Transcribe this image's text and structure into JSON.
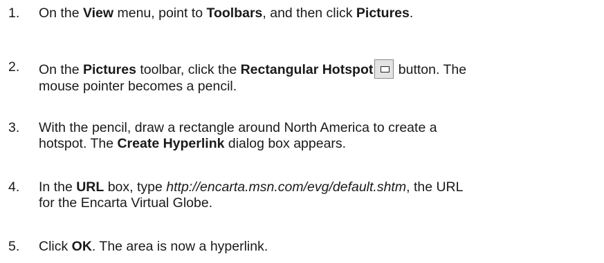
{
  "steps": [
    {
      "number": "1.",
      "parts": [
        "On the ",
        "View",
        " menu, point to ",
        "Toolbars",
        ", and then click ",
        "Pictures",
        "."
      ]
    },
    {
      "number": "2.",
      "line1_parts": [
        "On the ",
        "Pictures",
        " toolbar, click the ",
        "Rectangular Hotspot",
        " button. The"
      ],
      "line2": "mouse pointer becomes a pencil.",
      "icon": "rectangular-hotspot-icon"
    },
    {
      "number": "3.",
      "line1": "With the pencil, draw a rectangle around North America to create a",
      "line2_parts": [
        "hotspot. The ",
        "Create Hyperlink",
        " dialog box appears."
      ]
    },
    {
      "number": "4.",
      "line1_parts": [
        "In the ",
        "URL",
        " box, type ",
        "http://encarta.msn.com/evg/default.shtm",
        ", the URL"
      ],
      "line2": "for the Encarta Virtual Globe."
    },
    {
      "number": "5.",
      "parts": [
        "Click ",
        "OK",
        ". The area is now a hyperlink."
      ]
    }
  ]
}
